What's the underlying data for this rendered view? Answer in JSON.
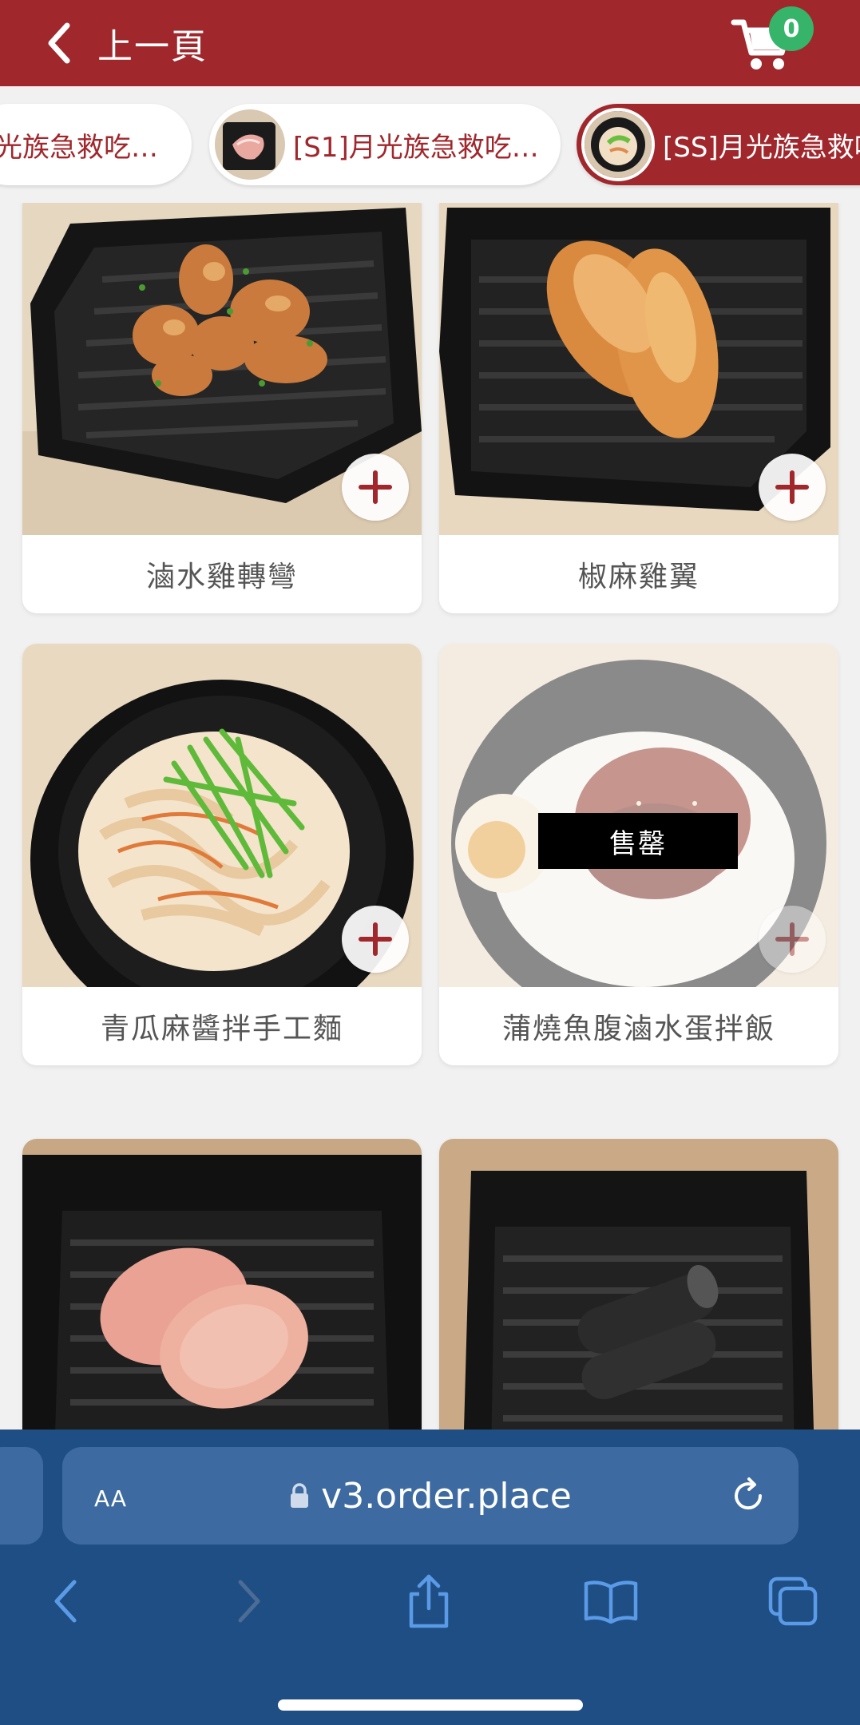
{
  "header": {
    "back_label": "上一頁",
    "cart_count": "0"
  },
  "categories": [
    {
      "label": "月光族急救吃到..."
    },
    {
      "label": "[S1]月光族急救吃到..."
    },
    {
      "label": "[SS]月光族急救吃到..."
    }
  ],
  "products": [
    {
      "name": "滷水雞轉彎"
    },
    {
      "name": "椒麻雞翼"
    },
    {
      "name": "青瓜麻醬拌手工麵"
    },
    {
      "name": "蒲燒魚腹滷水蛋拌飯",
      "badge": "售罄"
    },
    {
      "name": ""
    },
    {
      "name": ""
    }
  ],
  "browser": {
    "text_size_label": "AA",
    "url": "v3.order.place"
  },
  "colors": {
    "brand": "#a0272c",
    "badge": "#35b46a",
    "browser_bar": "#1f4e84"
  }
}
